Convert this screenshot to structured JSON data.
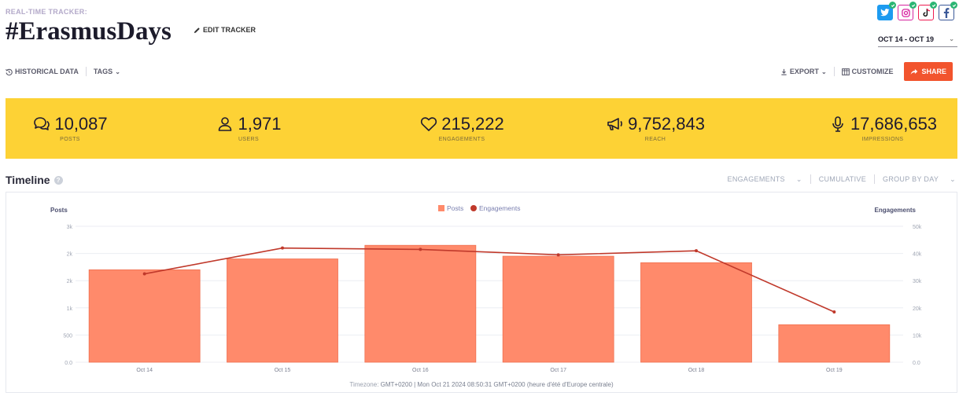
{
  "header": {
    "kicker": "REAL-TIME TRACKER:",
    "title": "#ErasmusDays",
    "edit_label": "EDIT TRACKER",
    "date_range": "OCT 14 - OCT 19",
    "socials": [
      {
        "name": "twitter-icon",
        "glyph": "🐦"
      },
      {
        "name": "instagram-icon",
        "glyph": "◎"
      },
      {
        "name": "tiktok-icon",
        "glyph": "♪"
      },
      {
        "name": "facebook-icon",
        "glyph": "f"
      }
    ]
  },
  "toolbar": {
    "historical": "HISTORICAL DATA",
    "tags": "TAGS",
    "export": "EXPORT",
    "customize": "CUSTOMIZE",
    "share": "SHARE"
  },
  "stats": [
    {
      "value": "10,087",
      "label": "POSTS",
      "icon": "posts-icon"
    },
    {
      "value": "1,971",
      "label": "USERS",
      "icon": "user-icon"
    },
    {
      "value": "215,222",
      "label": "ENGAGEMENTS",
      "icon": "heart-icon"
    },
    {
      "value": "9,752,843",
      "label": "REACH",
      "icon": "megaphone-icon"
    },
    {
      "value": "17,686,653",
      "label": "IMPRESSIONS",
      "icon": "microphone-icon"
    }
  ],
  "timeline": {
    "title": "Timeline",
    "metric": "ENGAGEMENTS",
    "cumulative": "CUMULATIVE",
    "group": "GROUP BY DAY",
    "timezone_label": "Timezone:",
    "timezone_value": "GMT+0200 | Mon Oct 21 2024 08:50:31 GMT+0200 (heure d'été d'Europe centrale)"
  },
  "colors": {
    "bar": "#ff8a6b",
    "bar_stroke": "#f07050",
    "line": "#c0392b",
    "accent": "#fdd235",
    "share": "#f2542d"
  },
  "chart_data": {
    "type": "bar",
    "categories": [
      "Oct 14",
      "Oct 15",
      "Oct 16",
      "Oct 17",
      "Oct 18",
      "Oct 19"
    ],
    "left_axis": {
      "label": "Posts",
      "ticks": [
        "0.0",
        "500",
        "1k",
        "2k",
        "2k",
        "3k"
      ],
      "max": 2500
    },
    "right_axis": {
      "label": "Engagements",
      "ticks": [
        "0.0",
        "10k",
        "20k",
        "30k",
        "40k",
        "50k"
      ],
      "max": 50000
    },
    "legend": [
      "Posts",
      "Engagements"
    ],
    "legend_placement": "top-center",
    "series": [
      {
        "name": "Posts",
        "type": "bar",
        "values": [
          1700,
          1900,
          2150,
          1950,
          1830,
          690
        ]
      },
      {
        "name": "Engagements",
        "type": "line",
        "values": [
          32500,
          42000,
          41500,
          39500,
          41000,
          18500
        ]
      }
    ]
  }
}
